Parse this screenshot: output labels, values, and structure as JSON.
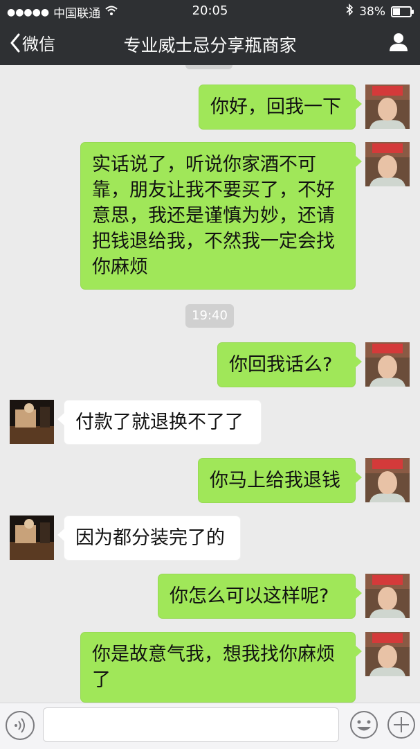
{
  "status_bar": {
    "signal_dots": "●●●●●",
    "carrier": "中国联通",
    "time": "20:05",
    "battery": "38%",
    "battery_level": 0.38
  },
  "nav": {
    "back_label": "微信",
    "title": "专业威士忌分享瓶商家"
  },
  "chat": {
    "timestamp": "19:40",
    "messages": [
      {
        "side": "sent",
        "text": "你好，回我一下"
      },
      {
        "side": "sent",
        "text": "实话说了，听说你家酒不可靠，朋友让我不要买了，不好意思，我还是谨慎为妙，还请把钱退给我，不然我一定会找你麻烦"
      },
      {
        "side": "sent",
        "text": "你回我话么?"
      },
      {
        "side": "recv",
        "text": "付款了就退换不了了"
      },
      {
        "side": "sent",
        "text": "你马上给我退钱"
      },
      {
        "side": "recv",
        "text": "因为都分装完了的"
      },
      {
        "side": "sent",
        "text": "你怎么可以这样呢?"
      },
      {
        "side": "sent",
        "text": "你是故意气我，想我找你麻烦了"
      }
    ]
  },
  "input_bar": {
    "placeholder": ""
  },
  "icons": {
    "back": "chevron-left-icon",
    "profile": "person-icon",
    "voice": "voice-icon",
    "emoji": "emoji-icon",
    "plus": "plus-icon",
    "wifi": "wifi-icon",
    "bluetooth": "bluetooth-icon"
  },
  "colors": {
    "nav_bg": "#2e3033",
    "chat_bg": "#ebebeb",
    "sent_bubble": "#a0e759",
    "recv_bubble": "#ffffff"
  }
}
